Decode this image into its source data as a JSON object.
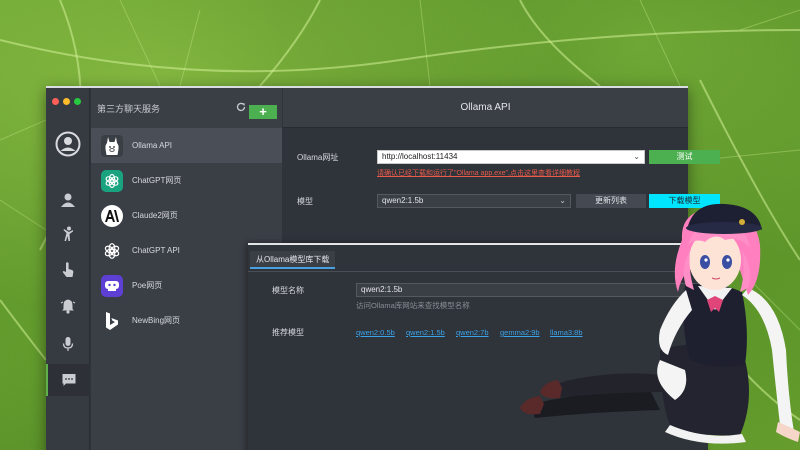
{
  "nav": {
    "icons": [
      "avatar-icon",
      "user-icon",
      "figure-icon",
      "touch-icon",
      "bell-icon",
      "mic-icon",
      "chat-icon"
    ]
  },
  "list": {
    "header": "第三方聊天服务",
    "add_label": "+",
    "items": [
      {
        "label": "Ollama API",
        "icon": "llama-icon"
      },
      {
        "label": "ChatGPT网页",
        "icon": "openai-icon"
      },
      {
        "label": "Claude2网页",
        "icon": "anthropic-icon"
      },
      {
        "label": "ChatGPT API",
        "icon": "openai-icon"
      },
      {
        "label": "Poe网页",
        "icon": "poe-icon"
      },
      {
        "label": "NewBing网页",
        "icon": "bing-icon"
      }
    ]
  },
  "main": {
    "title": "Ollama API",
    "url_label": "Ollama网址",
    "url_value": "http://localhost:11434",
    "test_button": "测试",
    "error": "请确认已经下载和运行了\"Ollama app.exe\",点击这里查看详细教程",
    "model_label": "模型",
    "model_value": "qwen2:1.5b",
    "refresh_button": "更新列表",
    "download_button": "下载模型"
  },
  "sub": {
    "tab": "从Ollama模型库下载",
    "name_label": "模型名称",
    "name_value": "qwen2:1.5b",
    "hint": "访问Ollama库网站来查找模型名称",
    "recommend_label": "推荐模型",
    "recommended": [
      "qwen2:0.5b",
      "qwen2:1.5b",
      "qwen2:7b",
      "gemma2:9b",
      "llama3:8b"
    ]
  },
  "colors": {
    "accent_green": "#4caf50",
    "accent_cyan": "#00e5ff",
    "link_blue": "#3ba3ea",
    "error_red": "#e85a4a"
  }
}
